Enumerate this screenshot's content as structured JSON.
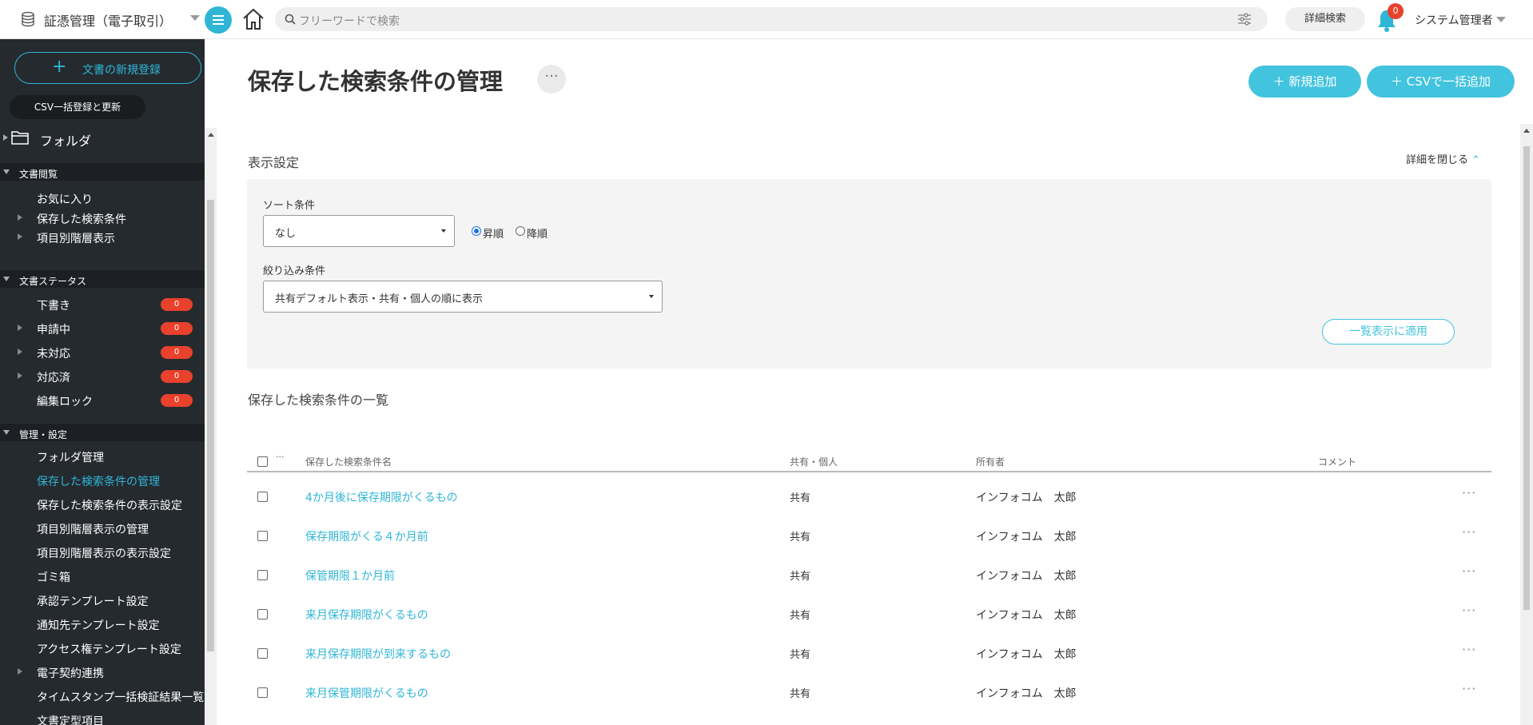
{
  "header": {
    "app_title": "証憑管理（電子取引）",
    "search_placeholder": "フリーワードで検索",
    "advanced_search_label": "詳細検索",
    "notification_count": "0",
    "user_name": "システム管理者"
  },
  "sidebar": {
    "new_document_label": "文書の新規登録",
    "csv_bulk_label": "CSV一括登録と更新",
    "folder_label": "フォルダ",
    "sections": {
      "browse": {
        "title": "文書閲覧",
        "items": [
          "お気に入り",
          "保存した検索条件",
          "項目別階層表示"
        ]
      },
      "status": {
        "title": "文書ステータス",
        "items": [
          {
            "label": "下書き",
            "count": "0"
          },
          {
            "label": "申請中",
            "count": "0"
          },
          {
            "label": "未対応",
            "count": "0"
          },
          {
            "label": "対応済",
            "count": "0"
          },
          {
            "label": "編集ロック",
            "count": "0"
          }
        ]
      },
      "admin": {
        "title": "管理・設定",
        "items": [
          "フォルダ管理",
          "保存した検索条件の管理",
          "保存した検索条件の表示設定",
          "項目別階層表示の管理",
          "項目別階層表示の表示設定",
          "ゴミ箱",
          "承認テンプレート設定",
          "通知先テンプレート設定",
          "アクセス権テンプレート設定",
          "電子契約連携",
          "タイムスタンプ一括検証結果一覧",
          "文書定型項目"
        ]
      }
    }
  },
  "main": {
    "page_title": "保存した検索条件の管理",
    "title_more": "···",
    "add_button": "新規追加",
    "csv_add_button": "CSVで一括追加",
    "display_settings_title": "表示設定",
    "collapse_label": "詳細を閉じる",
    "sort_label": "ソート条件",
    "sort_value": "なし",
    "order_asc": "昇順",
    "order_desc": "降順",
    "filter_label": "絞り込み条件",
    "filter_value": "共有デフォルト表示・共有・個人の順に表示",
    "apply_button": "一覧表示に適用",
    "list_title": "保存した検索条件の一覧",
    "table": {
      "header_dots": "···",
      "columns": [
        "保存した検索条件名",
        "共有・個人",
        "所有者",
        "コメント"
      ],
      "rows": [
        {
          "name": "4か月後に保存期限がくるもの",
          "share": "共有",
          "owner": "インフォコム　太郎"
        },
        {
          "name": "保存期限がくる４か月前",
          "share": "共有",
          "owner": "インフォコム　太郎"
        },
        {
          "name": "保管期限１か月前",
          "share": "共有",
          "owner": "インフォコム　太郎"
        },
        {
          "name": "来月保存期限がくるもの",
          "share": "共有",
          "owner": "インフォコム　太郎"
        },
        {
          "name": "来月保存期限が到来するもの",
          "share": "共有",
          "owner": "インフォコム　太郎"
        },
        {
          "name": "来月保管期限がくるもの",
          "share": "共有",
          "owner": "インフォコム　太郎"
        }
      ],
      "row_more": "···"
    }
  },
  "colors": {
    "accent": "#2fb6d6",
    "sidebar_bg": "#252a2f",
    "badge": "#e8412c"
  },
  "icons": [
    "database-icon",
    "menu-icon",
    "home-icon",
    "search-icon",
    "filter-settings-icon",
    "bell-icon",
    "folder-icon",
    "chevron-down-icon"
  ]
}
